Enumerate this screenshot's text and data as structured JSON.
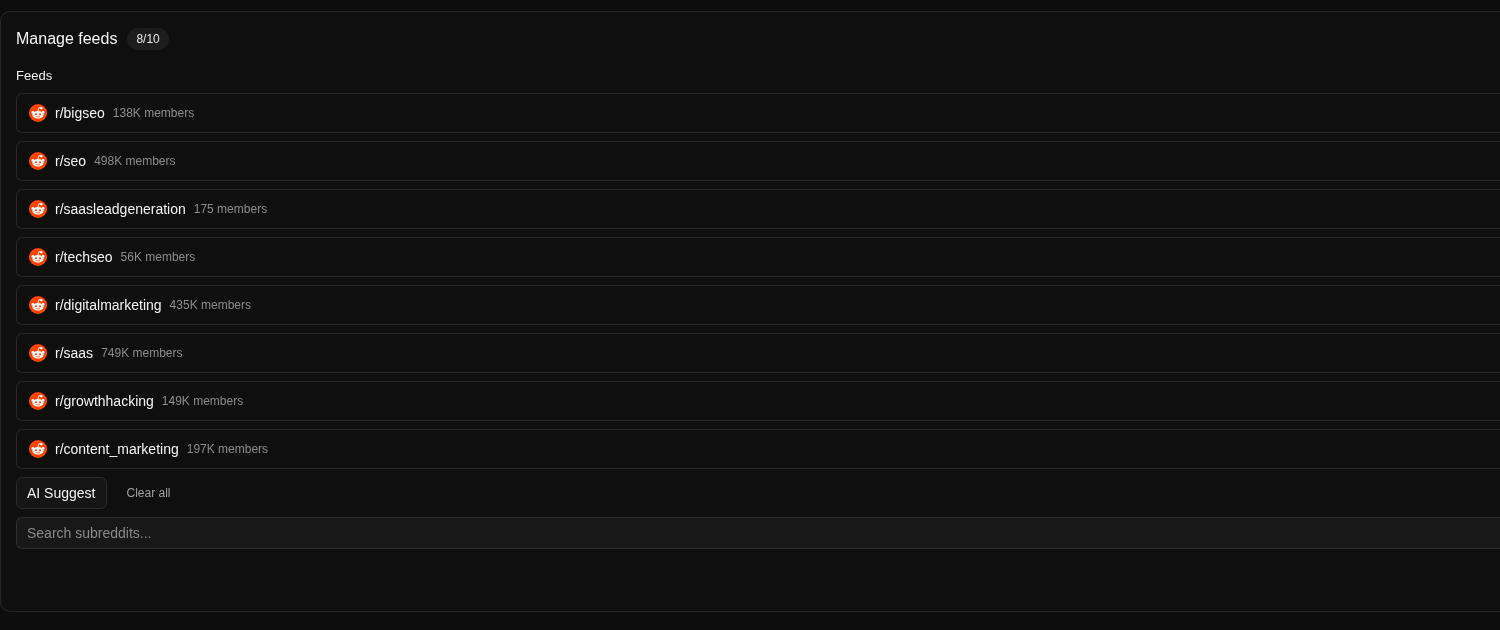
{
  "panel": {
    "title": "Manage feeds",
    "count_badge": "8/10",
    "section_label": "Feeds"
  },
  "feeds": [
    {
      "name": "r/bigseo",
      "members": "138K members"
    },
    {
      "name": "r/seo",
      "members": "498K members"
    },
    {
      "name": "r/saasleadgeneration",
      "members": "175 members"
    },
    {
      "name": "r/techseo",
      "members": "56K members"
    },
    {
      "name": "r/digitalmarketing",
      "members": "435K members"
    },
    {
      "name": "r/saas",
      "members": "749K members"
    },
    {
      "name": "r/growthhacking",
      "members": "149K members"
    },
    {
      "name": "r/content_marketing",
      "members": "197K members"
    }
  ],
  "actions": [
    {
      "label": "AI Suggest",
      "kind": "outlined"
    },
    {
      "label": "Clear all",
      "kind": "text"
    }
  ],
  "search": {
    "placeholder": "Search subreddits..."
  }
}
